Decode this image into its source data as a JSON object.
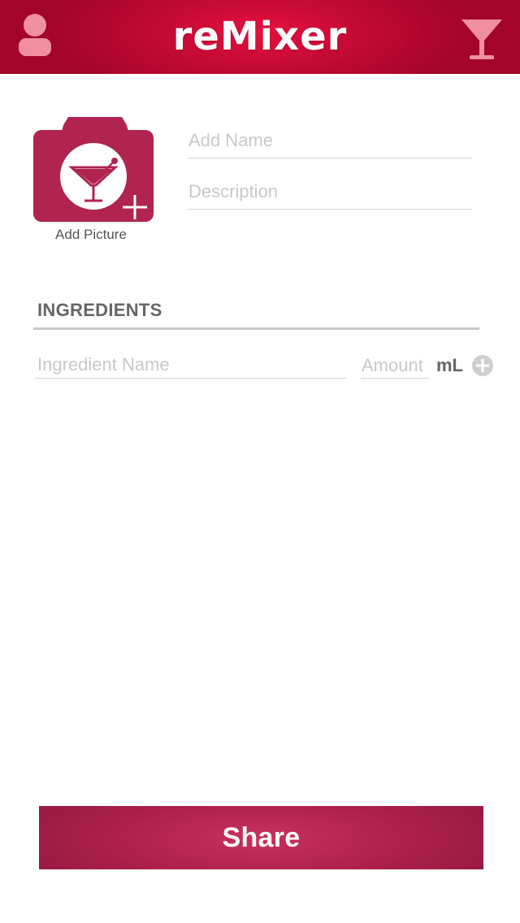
{
  "header": {
    "title": "reMixer",
    "profile_icon": "user-icon",
    "menu_icon": "cocktail-glass-icon"
  },
  "photo": {
    "label": "Add Picture",
    "icon": "camera-cocktail-icon"
  },
  "form": {
    "name_placeholder": "Add Name",
    "name_value": "",
    "description_placeholder": "Description",
    "description_value": ""
  },
  "ingredients": {
    "title": "INGREDIENTS",
    "name_placeholder": "Ingredient Name",
    "amount_placeholder": "Amount",
    "unit": "mL",
    "add_icon": "plus-circle-icon"
  },
  "footer": {
    "share_label": "Share"
  },
  "colors": {
    "header_red": "#c40a35",
    "accent_pink": "#b0214d",
    "muted_text": "#666666",
    "placeholder_gray": "#c8c8c8"
  }
}
